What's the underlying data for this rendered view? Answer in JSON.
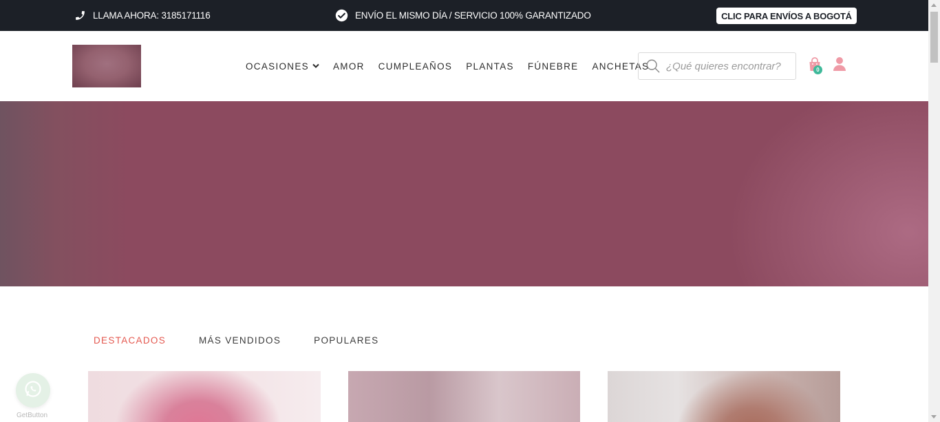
{
  "topbar": {
    "phone_text": "LLAMA AHORA: 3185171116",
    "phone_icon": "phone-icon",
    "promo_text": "ENVÍO EL MISMO DÍA / SERVICIO 100% GARANTIZADO",
    "promo_icon": "check-circle-icon",
    "bogota_button": "CLIC PARA ENVÍOS A BOGOTÁ",
    "background": "#1c2027"
  },
  "header": {
    "nav": [
      {
        "label": "OCASIONES",
        "has_dropdown": true
      },
      {
        "label": "AMOR"
      },
      {
        "label": "CUMPLEAÑOS"
      },
      {
        "label": "PLANTAS"
      },
      {
        "label": "FÚNEBRE"
      },
      {
        "label": "ANCHETAS"
      }
    ],
    "search_placeholder": "¿Qué quieres encontrar?",
    "cart_count": "0",
    "accent_color": "#ef9aa6",
    "badge_color": "#3fb99a"
  },
  "hero": {
    "color": "#8c4a5f"
  },
  "tabs": [
    {
      "label": "DESTACADOS",
      "active": true
    },
    {
      "label": "MÁS VENDIDOS",
      "active": false
    },
    {
      "label": "POPULARES",
      "active": false
    }
  ],
  "tab_active_color": "#e4584f",
  "whatsapp": {
    "icon": "whatsapp-icon",
    "label": "GetButton"
  }
}
